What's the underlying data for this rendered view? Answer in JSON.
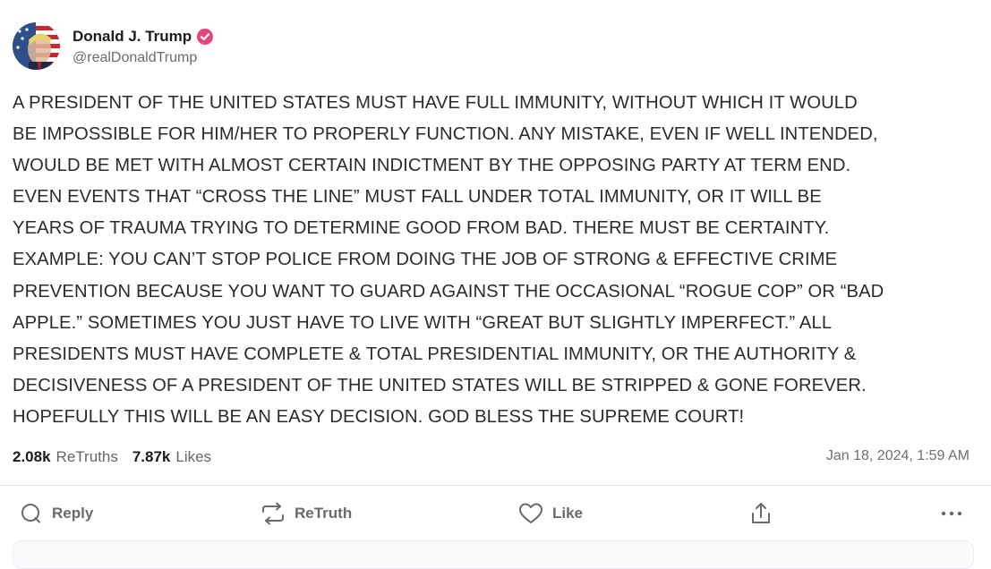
{
  "author": {
    "display_name": "Donald J. Trump",
    "handle": "@realDonaldTrump",
    "verified_color": "#e6447a"
  },
  "post": {
    "lines": [
      "A PRESIDENT OF THE UNITED STATES MUST HAVE FULL IMMUNITY, WITHOUT WHICH IT WOULD",
      "BE IMPOSSIBLE FOR HIM/HER TO PROPERLY FUNCTION. ANY MISTAKE, EVEN IF WELL INTENDED,",
      "WOULD BE MET WITH ALMOST CERTAIN INDICTMENT BY THE OPPOSING PARTY AT TERM END.",
      "EVEN EVENTS THAT “CROSS THE LINE” MUST FALL UNDER TOTAL IMMUNITY, OR IT WILL BE",
      "YEARS OF TRAUMA TRYING TO DETERMINE GOOD FROM BAD. THERE MUST BE CERTAINTY.",
      "EXAMPLE: YOU CAN’T STOP POLICE FROM DOING THE JOB OF STRONG & EFFECTIVE CRIME",
      "PREVENTION BECAUSE YOU WANT TO GUARD AGAINST THE OCCASIONAL “ROGUE COP” OR “BAD",
      "APPLE.” SOMETIMES YOU JUST HAVE TO LIVE WITH “GREAT BUT SLIGHTLY IMPERFECT.” ALL",
      "PRESIDENTS MUST HAVE COMPLETE & TOTAL PRESIDENTIAL IMMUNITY, OR THE AUTHORITY &",
      "DECISIVENESS OF A PRESIDENT OF THE UNITED STATES WILL BE STRIPPED & GONE FOREVER.",
      "HOPEFULLY THIS WILL BE AN EASY DECISION. GOD BLESS THE SUPREME COURT!"
    ]
  },
  "stats": {
    "retruths_count": "2.08k",
    "retruths_label": "ReTruths",
    "likes_count": "7.87k",
    "likes_label": "Likes",
    "timestamp": "Jan 18, 2024, 1:59 AM"
  },
  "actions": {
    "reply": {
      "label": "Reply",
      "icon": "reply-icon"
    },
    "retruth": {
      "label": "ReTruth",
      "icon": "retruth-icon"
    },
    "like": {
      "label": "Like",
      "icon": "heart-icon"
    },
    "share": {
      "icon": "share-icon"
    },
    "more": {
      "icon": "more-icon"
    }
  }
}
